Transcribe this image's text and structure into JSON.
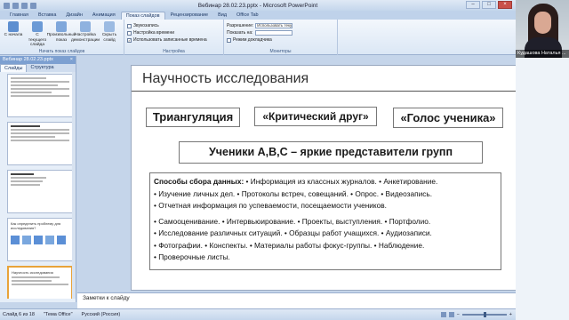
{
  "window": {
    "title": "Вебинар 28.02.23.pptx - Microsoft PowerPoint",
    "controls": {
      "minimize": "–",
      "maximize": "□",
      "close": "×"
    }
  },
  "ribbon": {
    "tabs": [
      "Главная",
      "Вставка",
      "Дизайн",
      "Анимация",
      "Показ слайдов",
      "Рецензирование",
      "Вид",
      "Office Tab"
    ],
    "active_tab": "Показ слайдов",
    "groups": [
      {
        "label": "Начать показ слайдов",
        "buttons": [
          "С начала",
          "С текущего слайда",
          "Произвольный показ",
          "Настройка демонстрации",
          "Скрыть слайд"
        ]
      },
      {
        "label": "Настройка",
        "items": [
          "Звукозапись",
          "Настройка времени",
          "Использовать записанные времена"
        ]
      },
      {
        "label": "Мониторы",
        "items": [
          "Разрешение:",
          "Показать на:",
          "Режим докладчика"
        ],
        "resolution_value": "Использовать теку...",
        "show_on_value": ""
      }
    ]
  },
  "left_pane": {
    "document_tab": "Вебинар 28.02.23.pptx",
    "close": "×",
    "tabs": [
      "Слайды",
      "Структура"
    ],
    "active_tab": "Слайды",
    "thumbnails": [
      {
        "num": "",
        "title": ""
      },
      {
        "num": "",
        "title": ""
      },
      {
        "num": "",
        "title": ""
      },
      {
        "num": "",
        "title": "Как определить проблему для исследования?"
      },
      {
        "num": "",
        "title": "Научность исследования"
      }
    ]
  },
  "slide": {
    "title": "Научность исследования",
    "box1": "Триангуляция",
    "box2": "«Критический друг»",
    "box3": "«Голос ученика»",
    "box4": "Ученики A,B,C – яркие представители групп",
    "methods_label": "Способы сбора данных:",
    "methods_lines": [
      " • Информация из классных журналов. • Анкетирование.",
      "• Изучение личных дел. • Протоколы встреч, совещаний. • Опрос. • Видеозапись.",
      "• Отчетная информация по успеваемости, посещаемости учеников."
    ],
    "methods_lines_2": [
      "• Самооценивание. • Интервьюирование. • Проекты, выступления. • Портфолио.",
      "• Исследование различных ситуаций. • Образцы работ учащихся. • Аудиозаписи.",
      "• Фотографии. • Конспекты. • Материалы работы фокус-группы. • Наблюдение.",
      "• Проверочные листы."
    ]
  },
  "notes": {
    "placeholder": "Заметки к слайду"
  },
  "status": {
    "slide_info": "Слайд 6 из 18",
    "theme": "\"Тема Office\"",
    "language": "Русский (Россия)"
  },
  "webcam": {
    "name": "Кудашова Наталья ..."
  }
}
